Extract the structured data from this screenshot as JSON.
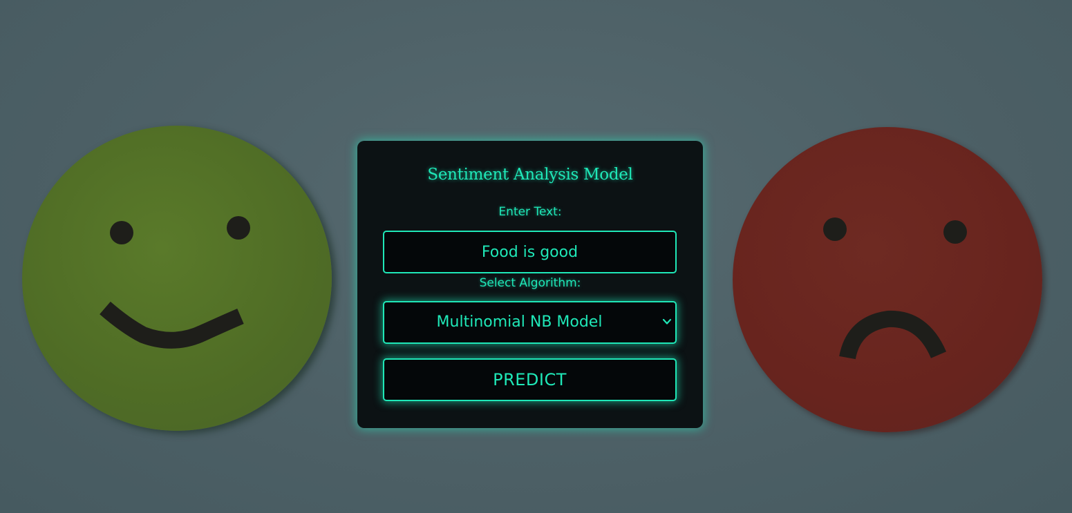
{
  "title": "Sentiment Analysis Model",
  "form": {
    "text_label": "Enter Text:",
    "text_value": "Food is good",
    "algorithm_label": "Select Algorithm:",
    "algorithm_selected": "Multinomial NB Model",
    "predict_label": "PREDICT"
  },
  "colors": {
    "accent": "#1fe8b8",
    "card_background": "#0c1214",
    "happy_face": "#4f6c25",
    "sad_face": "#68241e"
  },
  "icons": {
    "select_caret": "chevron-down-icon",
    "background_left": "happy-face-icon",
    "background_right": "sad-face-icon"
  }
}
